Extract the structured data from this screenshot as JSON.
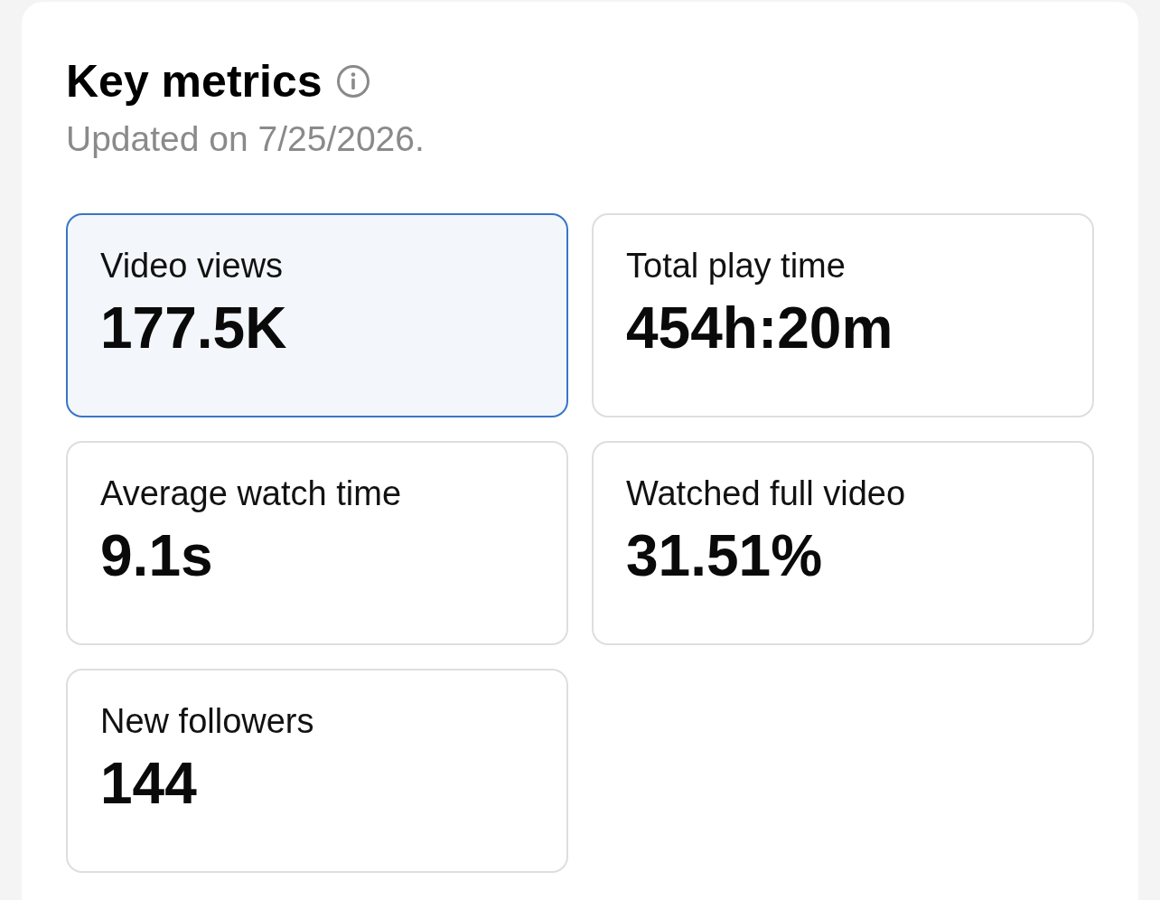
{
  "header": {
    "title": "Key metrics",
    "subtitle": "Updated on 7/25/2026."
  },
  "metrics": [
    {
      "label": "Video views",
      "value": "177.5K",
      "selected": true
    },
    {
      "label": "Total play time",
      "value": "454h:20m",
      "selected": false
    },
    {
      "label": "Average watch time",
      "value": "9.1s",
      "selected": false
    },
    {
      "label": "Watched full video",
      "value": "31.51%",
      "selected": false
    },
    {
      "label": "New followers",
      "value": "144",
      "selected": false
    }
  ]
}
